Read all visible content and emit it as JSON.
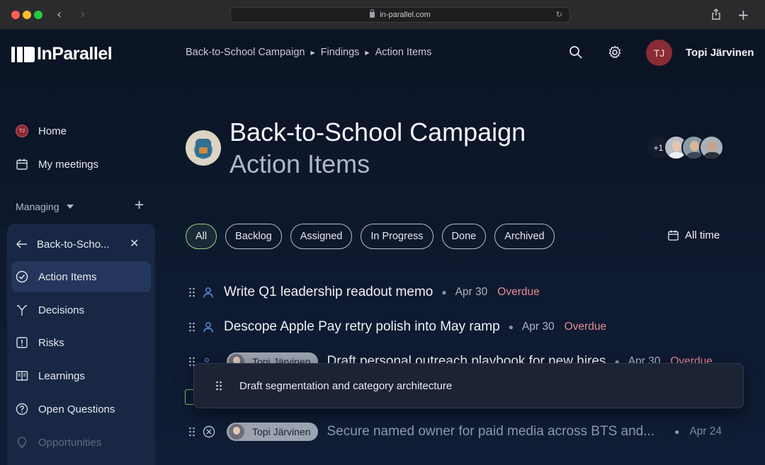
{
  "browser": {
    "url": "in-parallel.com"
  },
  "app": {
    "logo_text": "InParallel",
    "breadcrumb": [
      "Back-to-School Campaign",
      "Findings",
      "Action Items"
    ],
    "user": {
      "initials": "TJ",
      "name": "Topi Järvinen"
    }
  },
  "sidebar": {
    "home_avatar": "TJ",
    "items_top": [
      {
        "label": "Home",
        "icon": "avatar-icon"
      },
      {
        "label": "My meetings",
        "icon": "calendar-icon"
      }
    ],
    "managing_label": "Managing",
    "project_short": "Back-to-Scho...",
    "project_items": [
      {
        "label": "Action Items",
        "icon": "check-circle-icon"
      },
      {
        "label": "Decisions",
        "icon": "fork-icon"
      },
      {
        "label": "Risks",
        "icon": "alert-square-icon"
      },
      {
        "label": "Learnings",
        "icon": "book-icon"
      },
      {
        "label": "Open Questions",
        "icon": "question-circle-icon"
      },
      {
        "label": "Opportunities",
        "icon": "lightbulb-icon"
      }
    ]
  },
  "header": {
    "title": "Back-to-School Campaign",
    "subtitle": "Action Items",
    "participants_more": "+1"
  },
  "filters": {
    "chips": [
      "All",
      "Backlog",
      "Assigned",
      "In Progress",
      "Done",
      "Archived"
    ],
    "active": "All",
    "time_range": "All time"
  },
  "items": [
    {
      "title": "Write Q1 leadership readout memo",
      "date": "Apr 30",
      "status": "Overdue"
    },
    {
      "title": "Descope Apple Pay retry polish into May ramp",
      "date": "Apr 30",
      "status": "Overdue"
    },
    {
      "assignee": "Topi Järvinen",
      "title": "Draft personal outreach playbook for new hires",
      "date": "Apr 30",
      "status": "Overdue"
    },
    {
      "assignee": "Topi Järvinen",
      "title": "Secure named owner for paid media across BTS and...",
      "date": "Apr 24"
    }
  ],
  "dragging": {
    "title": "Draft segmentation and category architecture"
  }
}
